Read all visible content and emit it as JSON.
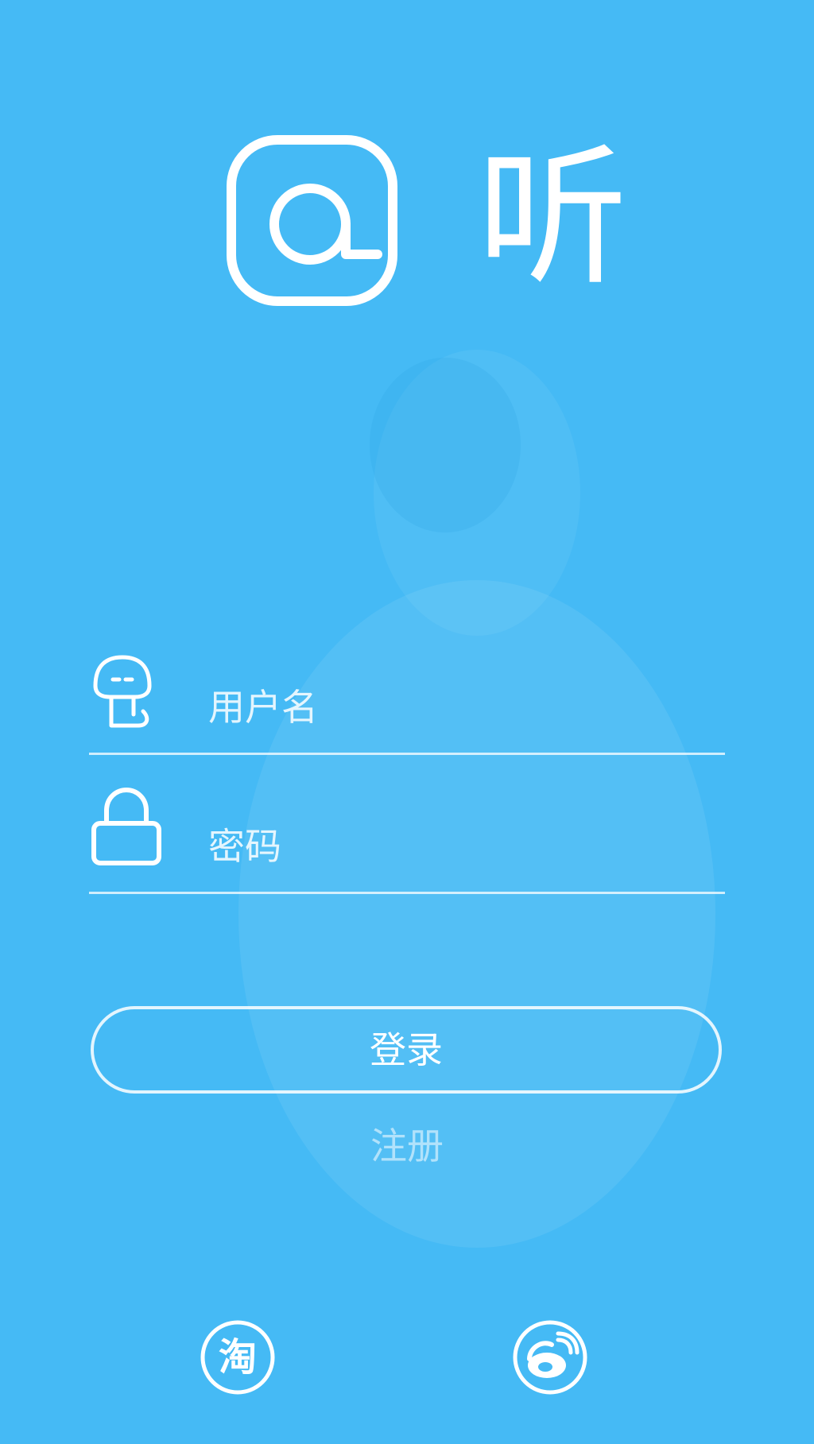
{
  "app": {
    "title": "听"
  },
  "login_form": {
    "username_placeholder": "用户名",
    "password_placeholder": "密码",
    "login_label": "登录",
    "register_label": "注册"
  },
  "social": {
    "taobao_glyph": "淘",
    "taobao_icon": "taobao-icon",
    "weibo_icon": "weibo-icon"
  },
  "colors": {
    "background": "#45baf5",
    "foreground": "#ffffff"
  }
}
